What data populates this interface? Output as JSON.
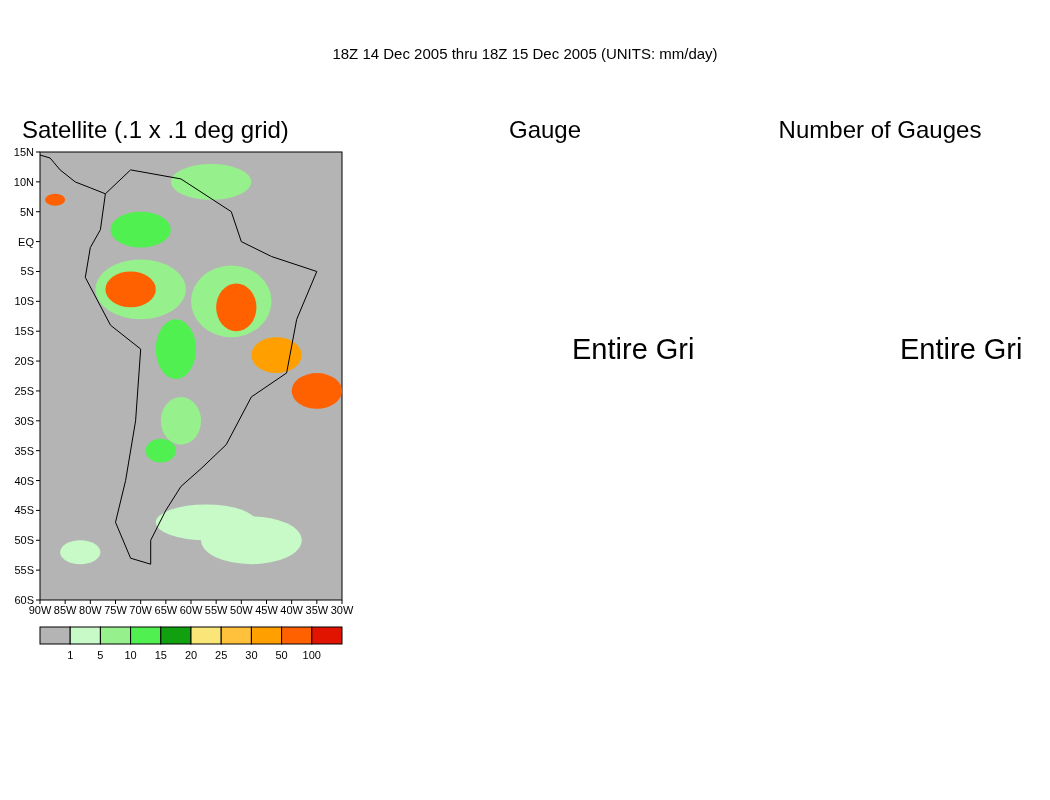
{
  "title": "18Z 14 Dec 2005 thru 18Z 15 Dec 2005 (UNITS: mm/day)",
  "panels": [
    {
      "kind": "map",
      "heading": "Satellite (.1 x .1 deg grid)",
      "lat_labels": [
        "15N",
        "10N",
        "5N",
        "EQ",
        "5S",
        "10S",
        "15S",
        "20S",
        "25S",
        "30S",
        "35S",
        "40S",
        "45S",
        "50S",
        "55S",
        "60S"
      ],
      "lon_labels": [
        "90W",
        "85W",
        "80W",
        "75W",
        "70W",
        "65W",
        "60W",
        "55W",
        "50W",
        "45W",
        "40W",
        "35W",
        "30W"
      ],
      "legend": [
        {
          "color": "#b4b4b4"
        },
        {
          "color": "#c8fac8"
        },
        {
          "color": "#96f08c"
        },
        {
          "color": "#50f050"
        },
        {
          "color": "#10a010"
        },
        {
          "color": "#fae678"
        },
        {
          "color": "#ffc03c"
        },
        {
          "color": "#ffa000"
        },
        {
          "color": "#ff6000"
        },
        {
          "color": "#e11400"
        }
      ],
      "legend_labels": [
        "1",
        "5",
        "10",
        "15",
        "20",
        "25",
        "30",
        "50",
        "100"
      ]
    },
    {
      "kind": "message",
      "heading": "Gauge",
      "message": "Entire Gri"
    },
    {
      "kind": "message",
      "heading": "Number of Gauges",
      "message": "Entire Gri"
    }
  ]
}
